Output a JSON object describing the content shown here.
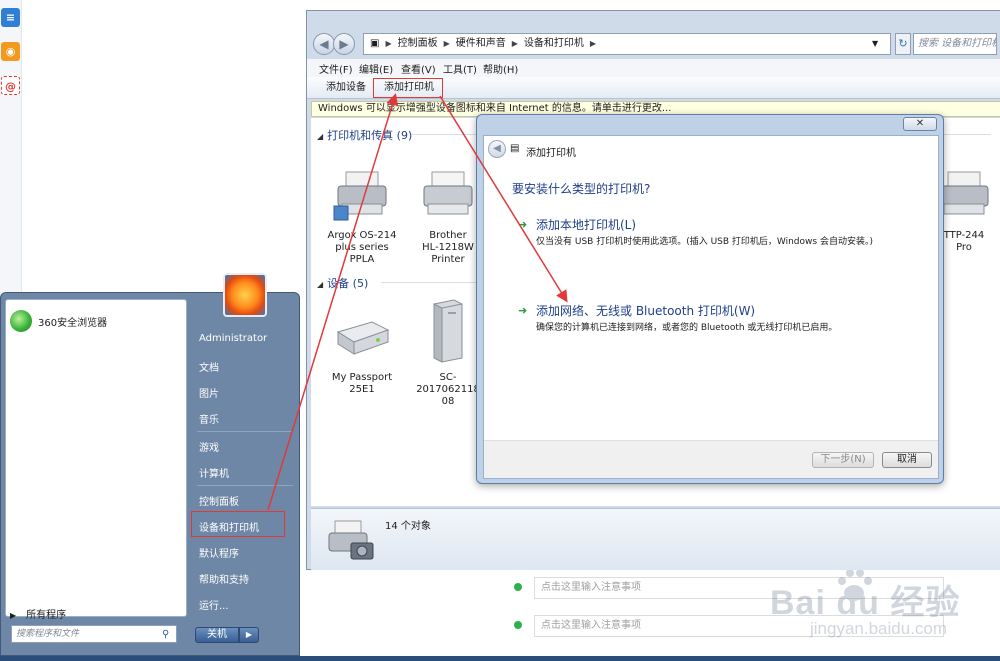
{
  "background": {
    "note_placeholder_1": "点击这里输入注意事项",
    "note_placeholder_2": "点击这里输入注意事项"
  },
  "watermark": {
    "logo": "Bai du 经验",
    "url": "jingyan.baidu.com"
  },
  "explorer": {
    "breadcrumb": [
      "控制面板",
      "硬件和声音",
      "设备和打印机"
    ],
    "search_placeholder": "搜索 设备和打印机",
    "menu": [
      "文件(F)",
      "编辑(E)",
      "查看(V)",
      "工具(T)",
      "帮助(H)"
    ],
    "toolbar": {
      "add_device": "添加设备",
      "add_printer": "添加打印机"
    },
    "infobar": "Windows 可以显示增强型设备图标和来自 Internet 的信息。请单击进行更改...",
    "groups": {
      "printers": {
        "title": "打印机和传真 (9)"
      },
      "devices": {
        "title": "设备 (5)"
      }
    },
    "printers": [
      {
        "line1": "Argox OS-214",
        "line2": "plus series",
        "line3": "PPLA"
      },
      {
        "line1": "Brother",
        "line2": "HL-1218W",
        "line3": "Printer"
      },
      {
        "line1": "TTP-244",
        "line2": "Pro"
      }
    ],
    "devices": [
      {
        "line1": "My Passport",
        "line2": "25E1"
      },
      {
        "line1": "SC-2017062118",
        "line2": "08"
      }
    ],
    "status": "14 个对象"
  },
  "dialog": {
    "close": "✕",
    "title": "添加打印机",
    "question": "要安装什么类型的打印机?",
    "option_local": {
      "title": "添加本地打印机(L)",
      "desc": "仅当没有 USB 打印机时使用此选项。(插入 USB 打印机后，Windows 会自动安装。)"
    },
    "option_network": {
      "title": "添加网络、无线或 Bluetooth 打印机(W)",
      "desc": "确保您的计算机已连接到网络，或者您的 Bluetooth 或无线打印机已启用。"
    },
    "next": "下一步(N)",
    "cancel": "取消"
  },
  "start_menu": {
    "pinned": [
      {
        "label": "360安全浏览器"
      }
    ],
    "all_programs": "所有程序",
    "search_placeholder": "搜索程序和文件",
    "right": {
      "user": "Administrator",
      "documents": "文档",
      "pictures": "图片",
      "music": "音乐",
      "games": "游戏",
      "computer": "计算机",
      "control_panel": "控制面板",
      "devices_printers": "设备和打印机",
      "default_programs": "默认程序",
      "help": "帮助和支持",
      "run": "运行..."
    },
    "shutdown": "关机"
  },
  "colors": {
    "annotation_red": "#e0393a",
    "link_blue": "#1e3f8a",
    "option_green": "#2a9a3c"
  }
}
